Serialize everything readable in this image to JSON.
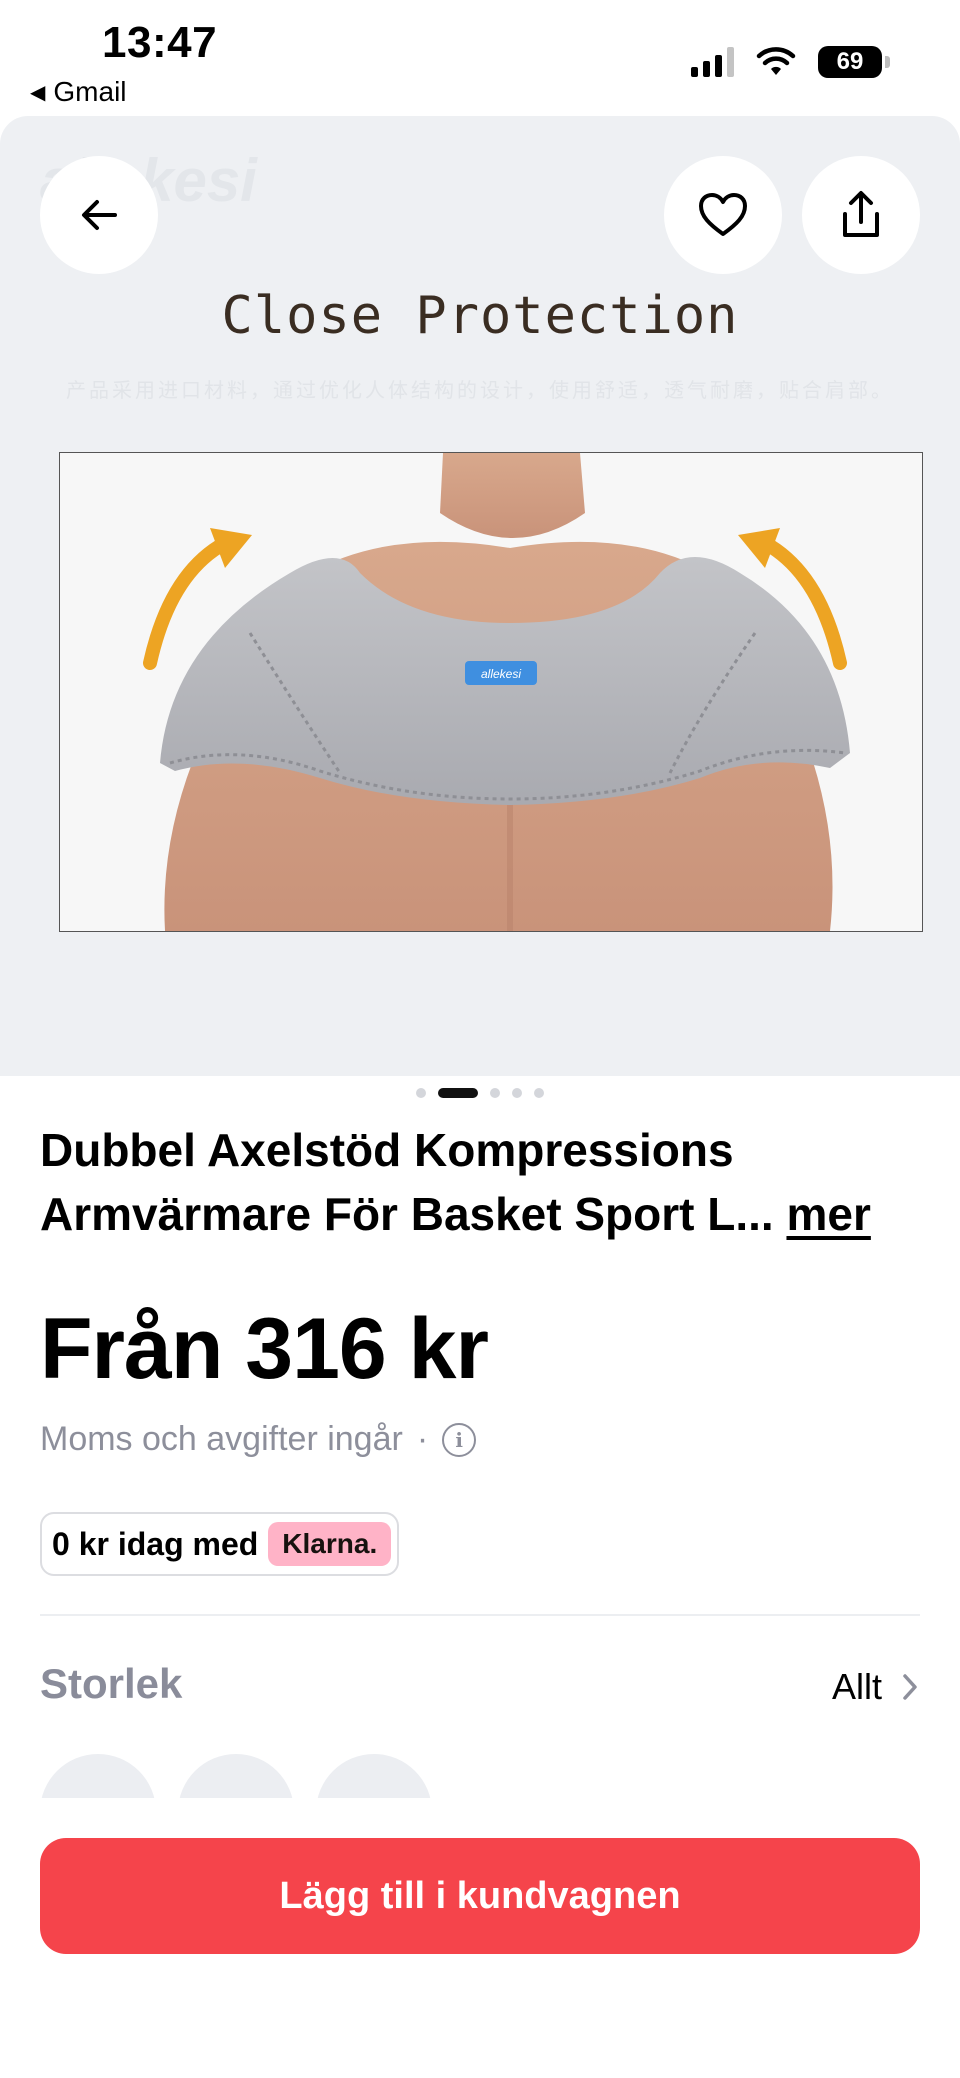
{
  "status_bar": {
    "time": "13:47",
    "back_app": "Gmail",
    "back_glyph": "◀",
    "battery": "69"
  },
  "hero": {
    "watermark": "allekesi",
    "headline": "Close Protection",
    "subline": "产品采用进口材料，通过优化人体结构的设计，使用舒适，透气耐磨，贴合肩部。",
    "logo_patch": "allekesi",
    "image_count": 5,
    "active_index": 1
  },
  "product": {
    "title": "Dubbel Axelstöd Kompressions Armvärmare För Basket Sport L...",
    "more": "mer",
    "price": "Från 316 kr",
    "tax_note": "Moms och avgifter ingår",
    "tax_sep": "·",
    "info_glyph": "i",
    "klarna_text": "0 kr idag med",
    "klarna_brand": "Klarna."
  },
  "size": {
    "label": "Storlek",
    "all": "Allt"
  },
  "cart": {
    "label": "Lägg till i kundvagnen"
  },
  "colors": {
    "accent": "#f5444b",
    "klarna": "#ffb3c7",
    "muted": "#8d8f9b"
  },
  "icons": [
    "back-arrow-icon",
    "heart-icon",
    "share-icon",
    "info-icon",
    "chevron-right-icon"
  ]
}
